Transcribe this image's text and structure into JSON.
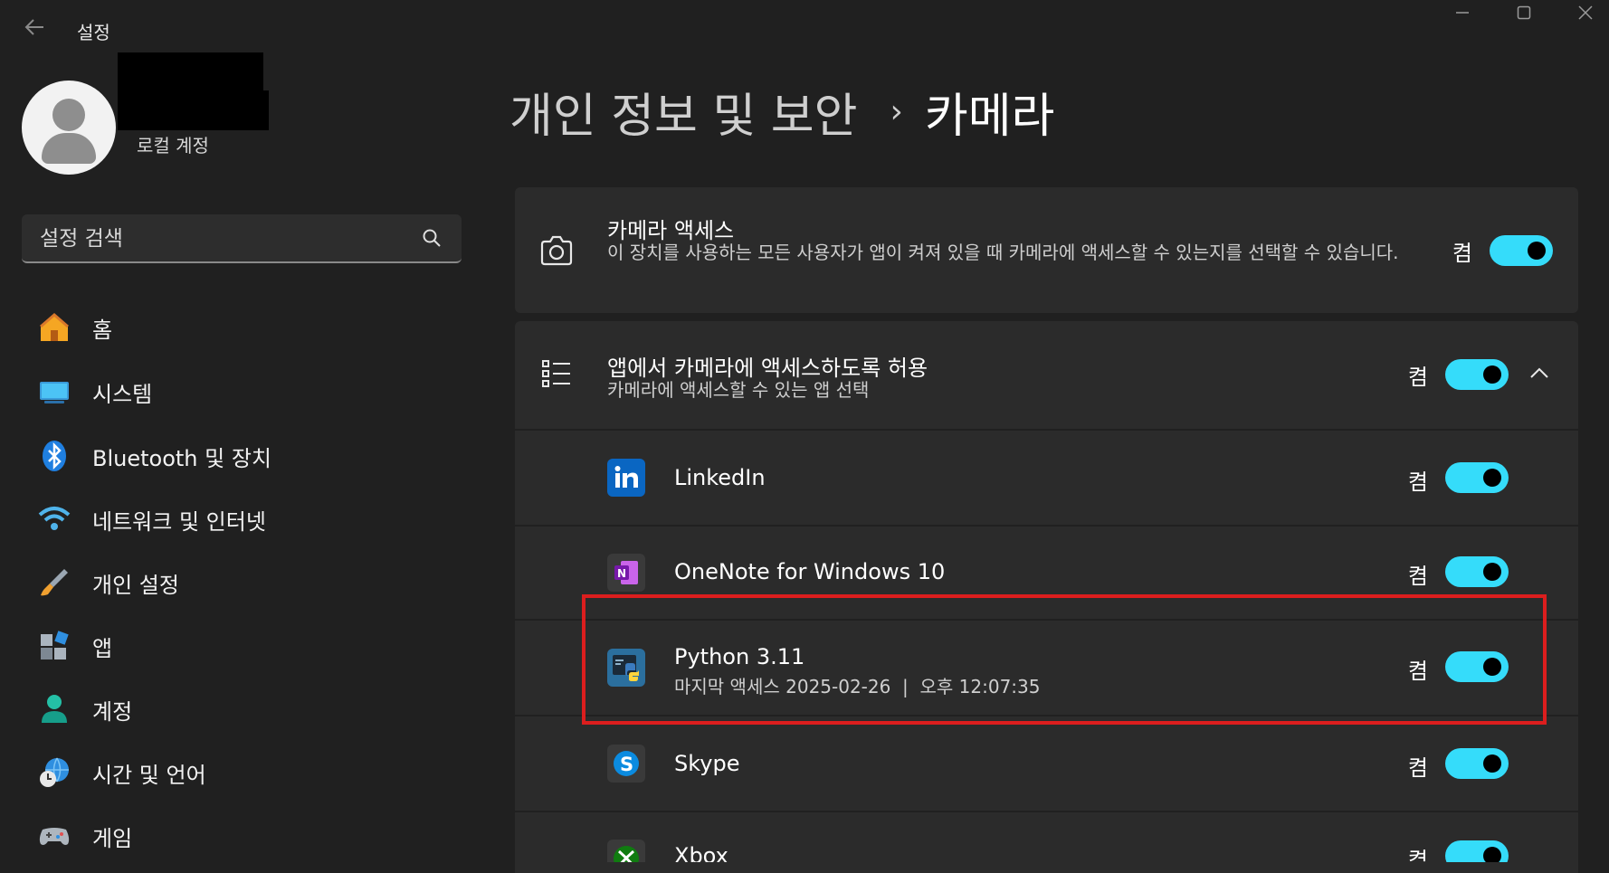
{
  "window": {
    "back_icon": "back-arrow-icon",
    "title": "설정"
  },
  "profile": {
    "account_type": "로컬 계정"
  },
  "search": {
    "placeholder": "설정 검색"
  },
  "nav": [
    {
      "label": "홈",
      "icon": "home-icon"
    },
    {
      "label": "시스템",
      "icon": "system-icon"
    },
    {
      "label": "Bluetooth 및 장치",
      "icon": "bluetooth-icon"
    },
    {
      "label": "네트워크 및 인터넷",
      "icon": "wifi-icon"
    },
    {
      "label": "개인 설정",
      "icon": "paintbrush-icon"
    },
    {
      "label": "앱",
      "icon": "apps-icon"
    },
    {
      "label": "계정",
      "icon": "account-icon"
    },
    {
      "label": "시간 및 언어",
      "icon": "time-language-icon"
    },
    {
      "label": "게임",
      "icon": "gamepad-icon"
    }
  ],
  "header": {
    "parent": "개인 정보 및 보안",
    "separator": "›",
    "current": "카메라"
  },
  "camera_access": {
    "title": "카메라 액세스",
    "description": "이 장치를 사용하는 모든 사용자가 앱이 켜져 있을 때 카메라에 액세스할 수 있는지를 선택할 수 있습니다.",
    "state": "켬",
    "on": true
  },
  "app_access": {
    "title": "앱에서 카메라에 액세스하도록 허용",
    "subtitle": "카메라에 액세스할 수 있는 앱 선택",
    "state": "켬",
    "on": true,
    "expanded": true
  },
  "apps": [
    {
      "name": "LinkedIn",
      "sub": "",
      "state": "켬",
      "on": true
    },
    {
      "name": "OneNote for Windows 10",
      "sub": "",
      "state": "켬",
      "on": true
    },
    {
      "name": "Python 3.11",
      "sub": "마지막 액세스 2025-02-26  |  오후 12:07:35",
      "state": "켬",
      "on": true,
      "highlighted": true
    },
    {
      "name": "Skype",
      "sub": "",
      "state": "켬",
      "on": true
    },
    {
      "name": "Xbox",
      "sub": "",
      "state": "켬",
      "on": true
    }
  ],
  "colors": {
    "accent": "#35dcfa",
    "highlight_border": "#dc1e1e",
    "background": "#202020",
    "card": "#2b2b2b"
  }
}
